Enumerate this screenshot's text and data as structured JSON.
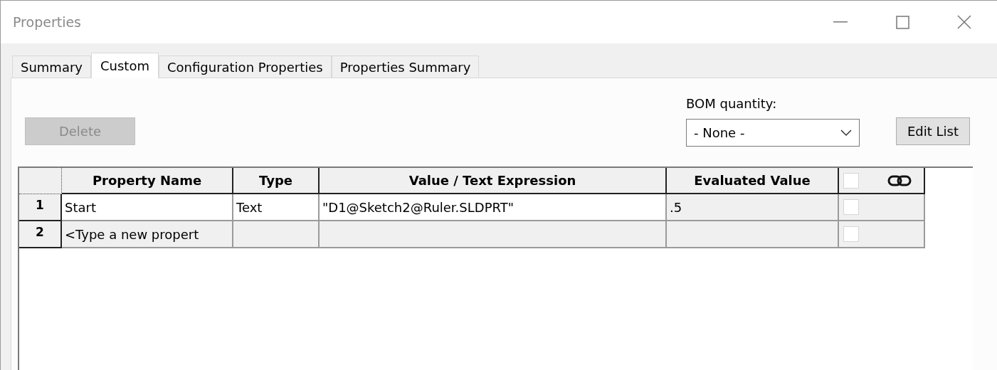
{
  "window": {
    "title": "Properties"
  },
  "tabs": [
    {
      "label": "Summary",
      "selected": false
    },
    {
      "label": "Custom",
      "selected": true
    },
    {
      "label": "Configuration Properties",
      "selected": false
    },
    {
      "label": "Properties Summary",
      "selected": false
    }
  ],
  "delete_button": {
    "label": "Delete",
    "disabled": true
  },
  "bom_quantity": {
    "label": "BOM quantity:",
    "value": "- None -"
  },
  "edit_list_button": {
    "label": "Edit List"
  },
  "table": {
    "columns": [
      "Property Name",
      "Type",
      "Value / Text Expression",
      "Evaluated Value"
    ],
    "header_checked": false,
    "rows": [
      {
        "number": "1",
        "cells": [
          "Start",
          "Text",
          "\"D1@Sketch2@Ruler.SLDPRT\"",
          ".5"
        ],
        "checked": false,
        "editable": true
      },
      {
        "number": "2",
        "cells": [
          "<Type a new propert",
          "",
          "",
          ""
        ],
        "checked": false,
        "editable": false
      }
    ]
  }
}
